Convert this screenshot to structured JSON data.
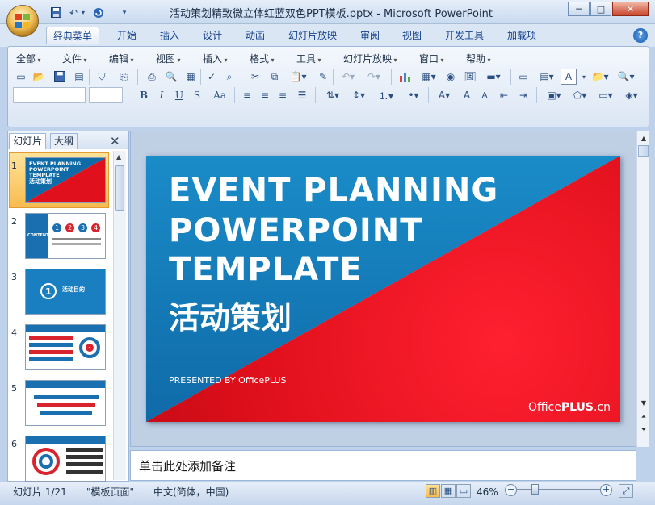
{
  "window": {
    "title": "活动策划精致微立体红蓝双色PPT模板.pptx - Microsoft PowerPoint",
    "controls": [
      "─",
      "□",
      "✕"
    ]
  },
  "quick_access": [
    "save-icon",
    "undo-icon",
    "redo-icon",
    "customize-icon"
  ],
  "ribbon_tabs": [
    "经典菜单",
    "开始",
    "插入",
    "设计",
    "动画",
    "幻灯片放映",
    "审阅",
    "视图",
    "开发工具",
    "加载项"
  ],
  "active_tab": "经典菜单",
  "help_label": "?",
  "classic_menus": [
    "全部",
    "文件",
    "编辑",
    "视图",
    "插入",
    "格式",
    "工具",
    "幻灯片放映",
    "窗口",
    "帮助"
  ],
  "format_buttons": {
    "bold": "B",
    "italic": "I",
    "underline": "U",
    "shadow": "S",
    "case": "Aa"
  },
  "left_pane": {
    "tabs": [
      "幻灯片",
      "大纲"
    ],
    "close": "✕",
    "slide_numbers": [
      "1",
      "2",
      "3",
      "4",
      "5",
      "6"
    ],
    "thumb1": {
      "line1": "EVENT PLANNING",
      "line2": "POWERPOINT",
      "line3": "TEMPLATE",
      "cn": "活动策划"
    },
    "thumb2": {
      "label": "CONTENTS",
      "nums": [
        "1",
        "2",
        "3",
        "4"
      ]
    },
    "thumb3": {
      "num": "1",
      "label": "活动目的"
    }
  },
  "slide": {
    "line1": "EVENT PLANNING",
    "line2": "POWERPOINT",
    "line3": "TEMPLATE",
    "cn_title": "活动策划",
    "presented": "PRESENTED BY OfficePLUS",
    "logo_prefix": "Office",
    "logo_bold": "PLUS",
    "logo_suffix": ".cn"
  },
  "notes_placeholder": "单击此处添加备注",
  "status": {
    "slide_info": "幻灯片 1/21",
    "theme": "\"模板页面\"",
    "language": "中文(简体，中国)",
    "zoom": "46%"
  },
  "colors": {
    "slide_blue": "#0f6aa8",
    "slide_red": "#e0101c",
    "ribbon_bg": "#dbe6f4"
  }
}
